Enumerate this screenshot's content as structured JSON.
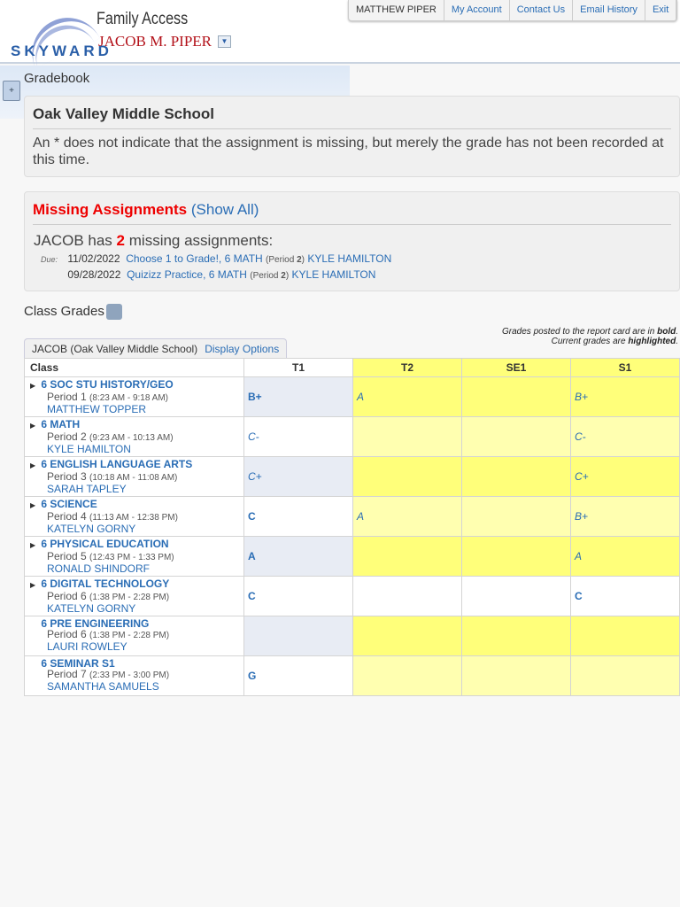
{
  "header": {
    "logo_text": "SKYWARD",
    "app_title": "Family Access",
    "student_name": "JACOB M. PIPER",
    "nav": {
      "user": "MATTHEW PIPER",
      "my_account": "My Account",
      "contact_us": "Contact Us",
      "email_history": "Email History",
      "exit": "Exit"
    }
  },
  "section": {
    "title": "Gradebook",
    "toggle": "+"
  },
  "school": {
    "name": "Oak Valley Middle School",
    "notice": "An * does not indicate that the assignment is missing, but merely the grade has not been recorded at this time."
  },
  "missing": {
    "title": "Missing Assignments",
    "show_all": "(Show All)",
    "prefix": "JACOB has",
    "count": "2",
    "suffix": "missing assignments:",
    "due_label": "Due:",
    "items": [
      {
        "date": "11/02/2022",
        "assignment": "Choose 1 to Grade!, 6 MATH",
        "period_label": "(Period",
        "period": "2",
        "close": ")",
        "teacher": "KYLE HAMILTON"
      },
      {
        "date": "09/28/2022",
        "assignment": "Quizizz Practice, 6 MATH",
        "period_label": "(Period",
        "period": "2",
        "close": ")",
        "teacher": "KYLE HAMILTON"
      }
    ]
  },
  "class_grades": {
    "title": "Class Grades",
    "legend_1a": "Grades posted to the report card are in ",
    "legend_1b": "bold",
    "legend_2a": "Current grades are ",
    "legend_2b": "highlighted",
    "tab_label": "JACOB (Oak Valley Middle School)",
    "display_options": "Display Options",
    "columns": [
      "Class",
      "T1",
      "T2",
      "SE1",
      "S1"
    ],
    "rows": [
      {
        "name": "6 SOC STU HISTORY/GEO",
        "expand": true,
        "period": "Period 1",
        "time": "(8:23 AM - 9:18 AM)",
        "teacher": "MATTHEW TOPPER",
        "highlight": true,
        "grades": [
          {
            "v": "B+",
            "bold": true
          },
          {
            "v": "A",
            "bold": false
          },
          {
            "v": "",
            "bold": false
          },
          {
            "v": "B+",
            "bold": false
          }
        ]
      },
      {
        "name": "6 MATH",
        "expand": true,
        "period": "Period 2",
        "time": "(9:23 AM - 10:13 AM)",
        "teacher": "KYLE HAMILTON",
        "highlight": true,
        "grades": [
          {
            "v": "C-",
            "bold": false
          },
          {
            "v": "",
            "bold": false
          },
          {
            "v": "",
            "bold": false
          },
          {
            "v": "C-",
            "bold": false
          }
        ]
      },
      {
        "name": "6 ENGLISH LANGUAGE ARTS",
        "expand": true,
        "period": "Period 3",
        "time": "(10:18 AM - 11:08 AM)",
        "teacher": "SARAH TAPLEY",
        "highlight": true,
        "grades": [
          {
            "v": "C+",
            "bold": false
          },
          {
            "v": "",
            "bold": false
          },
          {
            "v": "",
            "bold": false
          },
          {
            "v": "C+",
            "bold": false
          }
        ]
      },
      {
        "name": "6 SCIENCE",
        "expand": true,
        "period": "Period 4",
        "time": "(11:13 AM - 12:38 PM)",
        "teacher": "KATELYN GORNY",
        "highlight": true,
        "grades": [
          {
            "v": "C",
            "bold": true
          },
          {
            "v": "A",
            "bold": false
          },
          {
            "v": "",
            "bold": false
          },
          {
            "v": "B+",
            "bold": false
          }
        ]
      },
      {
        "name": "6 PHYSICAL EDUCATION",
        "expand": true,
        "period": "Period 5",
        "time": "(12:43 PM - 1:33 PM)",
        "teacher": "RONALD SHINDORF",
        "highlight": true,
        "grades": [
          {
            "v": "A",
            "bold": true
          },
          {
            "v": "",
            "bold": false
          },
          {
            "v": "",
            "bold": false
          },
          {
            "v": "A",
            "bold": false
          }
        ]
      },
      {
        "name": "6 DIGITAL TECHNOLOGY",
        "expand": true,
        "period": "Period 6",
        "time": "(1:38 PM - 2:28 PM)",
        "teacher": "KATELYN GORNY",
        "highlight": false,
        "grades": [
          {
            "v": "C",
            "bold": true
          },
          {
            "v": "",
            "bold": false
          },
          {
            "v": "",
            "bold": false
          },
          {
            "v": "C",
            "bold": true
          }
        ]
      },
      {
        "name": "6 PRE ENGINEERING",
        "expand": false,
        "period": "Period 6",
        "time": "(1:38 PM - 2:28 PM)",
        "teacher": "LAURI ROWLEY",
        "highlight": true,
        "grades": [
          {
            "v": "",
            "bold": false
          },
          {
            "v": "",
            "bold": false
          },
          {
            "v": "",
            "bold": false
          },
          {
            "v": "",
            "bold": false
          }
        ]
      },
      {
        "name": "6 SEMINAR S1",
        "expand": false,
        "period": "Period 7",
        "time": "(2:33 PM - 3:00 PM)",
        "teacher": "SAMANTHA SAMUELS",
        "highlight": true,
        "grades": [
          {
            "v": "G",
            "bold": true
          },
          {
            "v": "",
            "bold": false
          },
          {
            "v": "",
            "bold": false
          },
          {
            "v": "",
            "bold": false
          }
        ]
      }
    ]
  },
  "colors": {
    "highlight_dark": "#ffff7a",
    "highlight_light": "#ffffb0",
    "posted_shade": "#e8ecf4",
    "link": "#2a6db5",
    "alert": "#ee0000"
  }
}
